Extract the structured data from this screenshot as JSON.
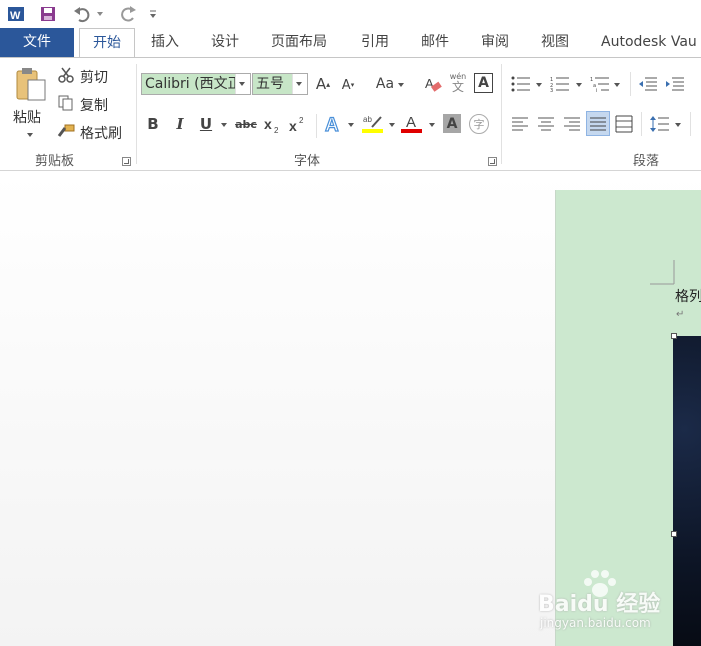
{
  "colors": {
    "file_tab": "#2b579a",
    "page_bg": "#cce8cf",
    "highlight_yellow": "#ffff00",
    "font_red": "#e00000",
    "selected_align_bg": "#c5d8ef"
  },
  "tabs": [
    "文件",
    "开始",
    "插入",
    "设计",
    "页面布局",
    "引用",
    "邮件",
    "审阅",
    "视图",
    "Autodesk Vau"
  ],
  "clipboard": {
    "paste": "粘贴",
    "cut": "剪切",
    "copy": "复制",
    "format_painter": "格式刷",
    "group_label": "剪贴板"
  },
  "font": {
    "name": "Calibri (西文正",
    "size": "五号",
    "group_label": "字体",
    "phonetic_top": "wén",
    "phonetic_bottom": "文",
    "bold": "B",
    "italic": "I",
    "underline": "U",
    "strike": "abc",
    "change_case": "Aa",
    "encircle": "字"
  },
  "paragraph": {
    "group_label": "段落"
  },
  "document": {
    "text_line": "格列",
    "para_mark": "↵"
  },
  "watermark": {
    "logo": "Baidu 经验",
    "url": "jingyan.baidu.com"
  }
}
